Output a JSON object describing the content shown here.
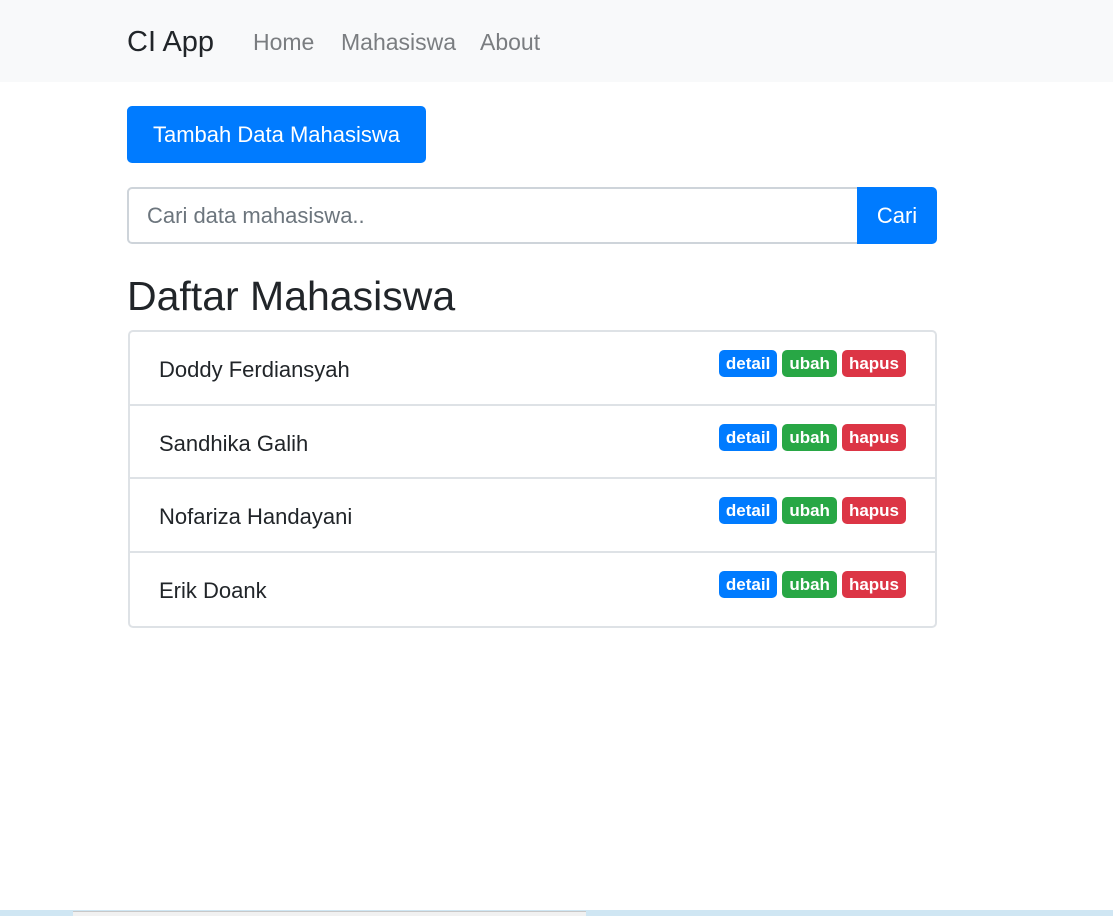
{
  "navbar": {
    "brand": "CI App",
    "links": [
      "Home",
      "Mahasiswa",
      "About"
    ]
  },
  "actions": {
    "add_label": "Tambah Data Mahasiswa"
  },
  "search": {
    "placeholder": "Cari data mahasiswa..",
    "value": "",
    "button_label": "Cari"
  },
  "page": {
    "title": "Daftar Mahasiswa"
  },
  "badge_labels": {
    "detail": "detail",
    "ubah": "ubah",
    "hapus": "hapus"
  },
  "students": [
    {
      "name": "Doddy Ferdiansyah"
    },
    {
      "name": "Sandhika Galih"
    },
    {
      "name": "Nofariza Handayani"
    },
    {
      "name": "Erik Doank"
    }
  ],
  "colors": {
    "primary": "#007bff",
    "success": "#28a745",
    "danger": "#dc3545",
    "navbar_bg": "#f8f9fa"
  }
}
